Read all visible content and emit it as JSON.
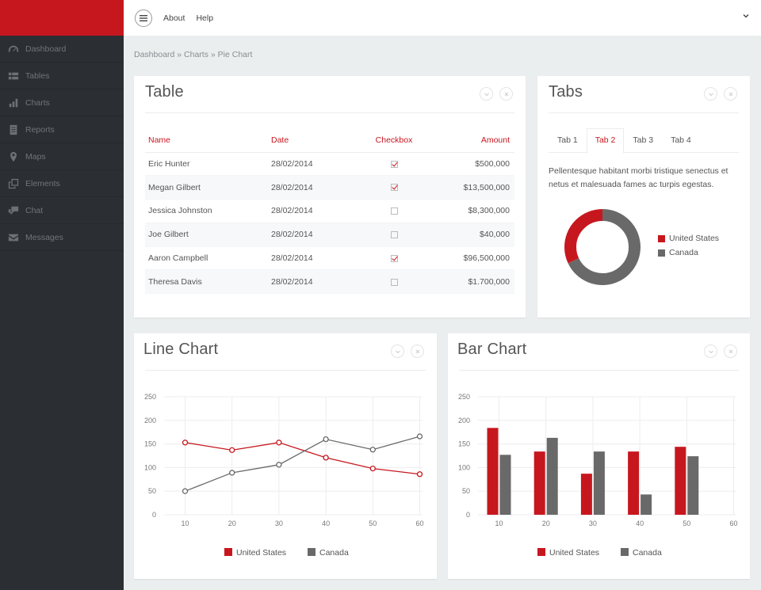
{
  "topbar": {
    "links": [
      "About",
      "Help"
    ]
  },
  "sidebar": {
    "items": [
      {
        "label": "Dashboard",
        "icon": "dashboard-icon"
      },
      {
        "label": "Tables",
        "icon": "table-icon"
      },
      {
        "label": "Charts",
        "icon": "bar-chart-icon"
      },
      {
        "label": "Reports",
        "icon": "document-icon"
      },
      {
        "label": "Maps",
        "icon": "map-pin-icon"
      },
      {
        "label": "Elements",
        "icon": "copy-icon"
      },
      {
        "label": "Chat",
        "icon": "chat-icon"
      },
      {
        "label": "Messages",
        "icon": "envelope-icon"
      }
    ]
  },
  "breadcrumb": "Dashboard » Charts » Pie Chart",
  "table_panel": {
    "title": "Table",
    "headers": [
      "Name",
      "Date",
      "Checkbox",
      "Amount"
    ],
    "rows": [
      {
        "name": "Eric Hunter",
        "date": "28/02/2014",
        "checked": true,
        "amount": "$500,000"
      },
      {
        "name": "Megan Gilbert",
        "date": "28/02/2014",
        "checked": true,
        "amount": "$13,500,000"
      },
      {
        "name": "Jessica Johnston",
        "date": "28/02/2014",
        "checked": false,
        "amount": "$8,300,000"
      },
      {
        "name": "Joe Gilbert",
        "date": "28/02/2014",
        "checked": false,
        "amount": "$40,000"
      },
      {
        "name": "Aaron Campbell",
        "date": "28/02/2014",
        "checked": true,
        "amount": "$96,500,000"
      },
      {
        "name": "Theresa Davis",
        "date": "28/02/2014",
        "checked": false,
        "amount": "$1.700,000"
      }
    ]
  },
  "tabs_panel": {
    "title": "Tabs",
    "tabs": [
      "Tab 1",
      "Tab 2",
      "Tab 3",
      "Tab 4"
    ],
    "active_tab": 1,
    "text": "Pellentesque habitant morbi tristique senectus et netus et malesuada fames ac turpis egestas."
  },
  "line_panel": {
    "title": "Line Chart"
  },
  "bar_panel": {
    "title": "Bar Chart"
  },
  "colors": {
    "accent": "#c7171e",
    "secondary": "#696969",
    "sidebar": "#2b2e33"
  },
  "chart_data": [
    {
      "type": "pie",
      "title": "",
      "labels": [
        "United States",
        "Canada"
      ],
      "values": [
        32,
        68
      ],
      "colors": [
        "#c7171e",
        "#696969"
      ],
      "legend": "right"
    },
    {
      "type": "line",
      "title": "",
      "x": [
        10,
        20,
        30,
        40,
        50,
        60
      ],
      "series": [
        {
          "name": "United States",
          "values": [
            153,
            137,
            153,
            121,
            98,
            86
          ],
          "color": "#c7171e"
        },
        {
          "name": "Canada",
          "values": [
            50,
            89,
            106,
            160,
            138,
            166
          ],
          "color": "#696969"
        }
      ],
      "ylim": [
        0,
        250
      ],
      "yticks": [
        0,
        50,
        100,
        150,
        200,
        250
      ],
      "grid": true,
      "legend": "bottom"
    },
    {
      "type": "bar",
      "title": "",
      "categories": [
        10,
        20,
        30,
        40,
        50,
        60
      ],
      "series": [
        {
          "name": "United States",
          "values": [
            184,
            134,
            87,
            134,
            144,
            null
          ],
          "color": "#c7171e"
        },
        {
          "name": "Canada",
          "values": [
            127,
            163,
            134,
            43,
            124,
            null
          ],
          "color": "#696969"
        }
      ],
      "ylim": [
        0,
        250
      ],
      "yticks": [
        0,
        50,
        100,
        150,
        200,
        250
      ],
      "grid": true,
      "legend": "bottom"
    }
  ]
}
